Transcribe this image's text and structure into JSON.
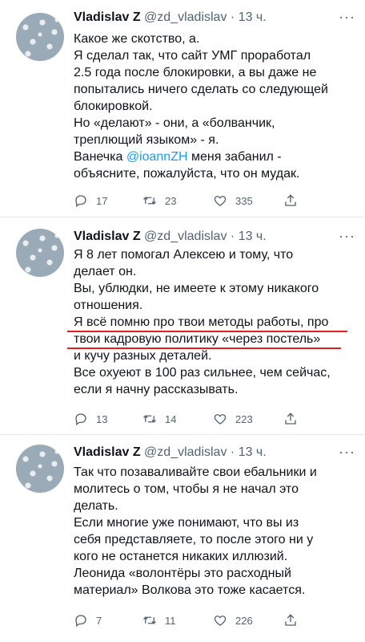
{
  "tweets": [
    {
      "name": "Vladislav Z",
      "handle": "@zd_vladislav",
      "sep": "·",
      "time": "13 ч.",
      "lines": [
        "Какое же скотство, а.",
        "Я сделал так, что сайт УМГ проработал",
        "2.5 года после блокировки, а вы даже не",
        "попытались ничего сделать со следующей",
        "блокировкой.",
        "Но «делают» - они, а «болванчик,",
        "треплющий языком» - я."
      ],
      "mention_prefix": "Ванечка ",
      "mention": "@ioannZH",
      "mention_suffix": " меня забанил -",
      "last_line": "объясните, пожалуйста, что он мудак.",
      "reply_count": "17",
      "retweet_count": "23",
      "like_count": "335"
    },
    {
      "name": "Vladislav Z",
      "handle": "@zd_vladislav",
      "sep": "·",
      "time": "13 ч.",
      "lines": [
        "Я 8 лет помогал Алексею и тому, что",
        "делает он.",
        "Вы, ублюдки, не имеете к этому никакого",
        "отношения.",
        "Я всё помню про твои методы работы, про",
        "твои кадровую политику «через постель»",
        "и кучу разных деталей.",
        "Все охуеют в 100 раз сильнее, чем сейчас,",
        "если я начну рассказывать."
      ],
      "reply_count": "13",
      "retweet_count": "14",
      "like_count": "223"
    },
    {
      "name": "Vladislav Z",
      "handle": "@zd_vladislav",
      "sep": "·",
      "time": "13 ч.",
      "lines": [
        "Так что позаваливайте свои ебальники и",
        "молитесь о том, чтобы я не начал это",
        "делать.",
        "Если многие уже понимают, что вы из",
        "себя представляете, то после этого ни у",
        "кого не останется никаких иллюзий.",
        "Леонида «волонтёры это расходный",
        "материал» Волкова это тоже касается."
      ],
      "reply_count": "7",
      "retweet_count": "11",
      "like_count": "226"
    }
  ],
  "icons": {
    "reply": "reply-icon",
    "retweet": "retweet-icon",
    "like": "heart-icon",
    "share": "share-icon",
    "more": "more-icon"
  },
  "colors": {
    "text": "#0f1419",
    "secondary": "#536471",
    "link": "#1d9bf0",
    "highlight_underline": "#e0211b"
  }
}
